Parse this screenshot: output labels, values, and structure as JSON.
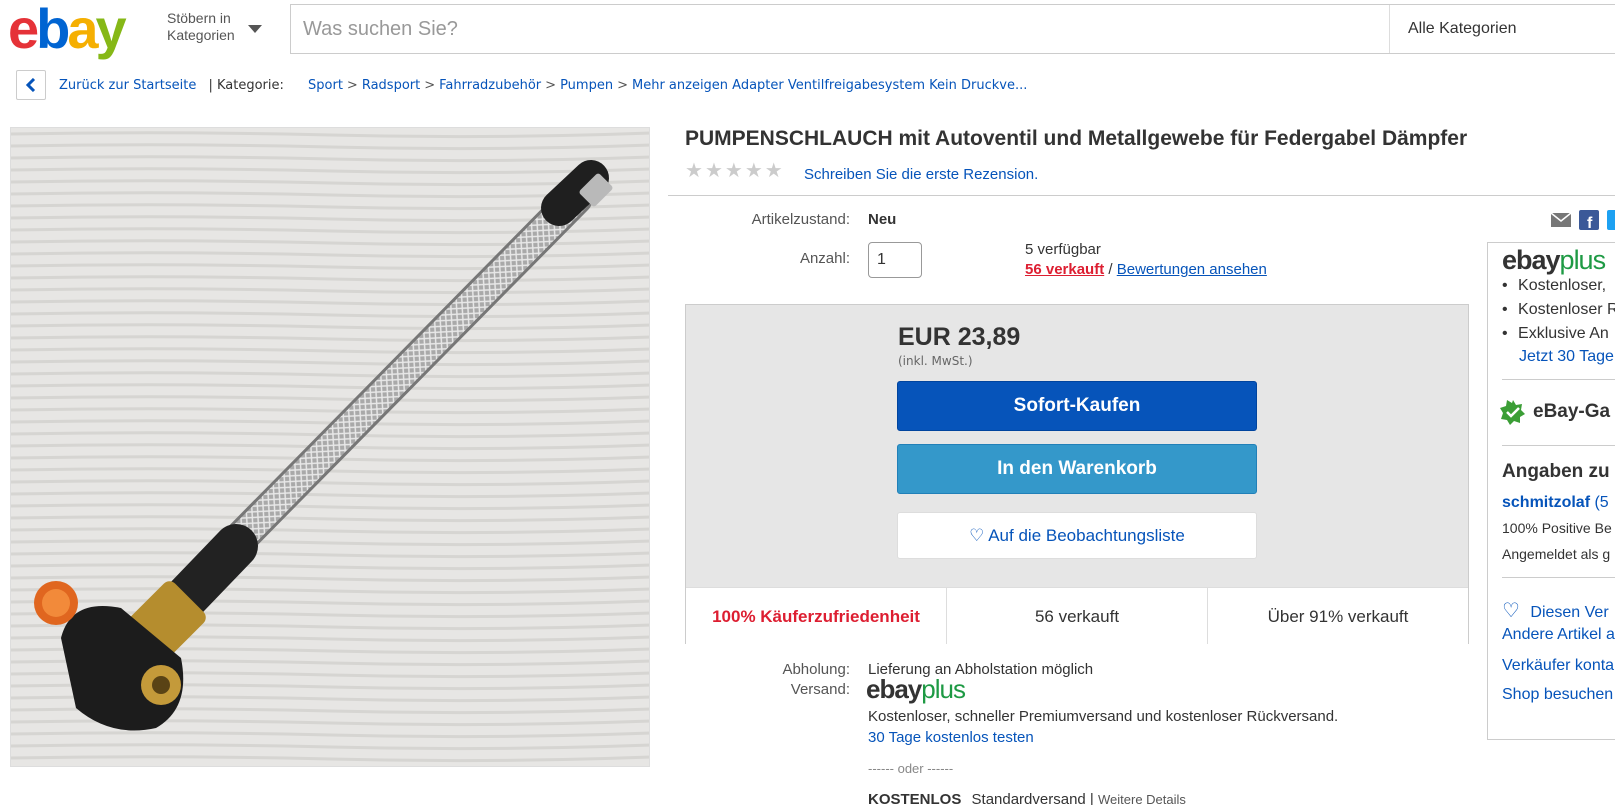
{
  "header": {
    "logo_text": "ebay",
    "browse_line1": "Stöbern in",
    "browse_line2": "Kategorien",
    "search_placeholder": "Was suchen Sie?",
    "category_select": "Alle Kategorien"
  },
  "breadcrumb": {
    "back_label": "Zurück zur Startseite",
    "category_label": "| Kategorie:",
    "items": [
      "Sport",
      "Radsport",
      "Fahrradzubehör",
      "Pumpen",
      "Mehr anzeigen Adapter Ventilfreigabesystem Kein Druckve..."
    ]
  },
  "product": {
    "title": "PUMPENSCHLAUCH mit Autoventil und Metallgewebe für Federgabel Dämpfer",
    "rating_stars": 0,
    "review_link": "Schreiben Sie die erste Rezension.",
    "condition_label": "Artikelzustand:",
    "condition_value": "Neu",
    "quantity_label": "Anzahl:",
    "quantity_value": "1",
    "available": "5 verfügbar",
    "sold_link": "56 verkauft",
    "slash": "/",
    "reviews_link": "Bewertungen ansehen"
  },
  "buybox": {
    "price": "EUR 23,89",
    "vat": "(inkl. MwSt.)",
    "buy_now": "Sofort-Kaufen",
    "add_to_cart": "In den Warenkorb",
    "watch": "Auf die Beobachtungsliste",
    "stats": [
      "100% Käuferzufriedenheit",
      "56 verkauft",
      "Über 91% verkauft"
    ]
  },
  "shipping": {
    "pickup_label": "Abholung:",
    "pickup_value": "Lieferung an Abholstation möglich",
    "shipping_label": "Versand:",
    "ebayplus_desc": "Kostenloser, schneller Premiumversand und kostenloser Rückversand.",
    "trial_link": "30 Tage kostenlos testen",
    "or": "------ oder ------",
    "free_label": "KOSTENLOS",
    "standard": "Standardversand |",
    "details_link": "Weitere Details"
  },
  "ebayplus": {
    "ebay": "ebay",
    "plus": "plus"
  },
  "right_panel": {
    "bullets": [
      "Kostenloser,",
      "Kostenloser R",
      "Exklusive An"
    ],
    "trial": "Jetzt 30 Tage",
    "guarantee": "eBay-Ga",
    "seller_heading": "Angaben zu",
    "seller_name": "schmitzolaf",
    "seller_name_suffix": "(5",
    "positive": "100% Positive Be",
    "registered": "Angemeldet als g",
    "follow": "Diesen Ver",
    "other_items": "Andere Artikel a",
    "contact": "Verkäufer konta",
    "shop": "Shop besuchen"
  },
  "colors": {
    "ebay_red": "#e53238",
    "ebay_blue": "#0064d2",
    "ebay_yellow": "#f5af02",
    "ebay_green": "#86b817",
    "link_blue": "#0654ba",
    "buy_blue": "#0654ba",
    "cart_blue": "#3498ca",
    "alert_red": "#dd1e31"
  }
}
